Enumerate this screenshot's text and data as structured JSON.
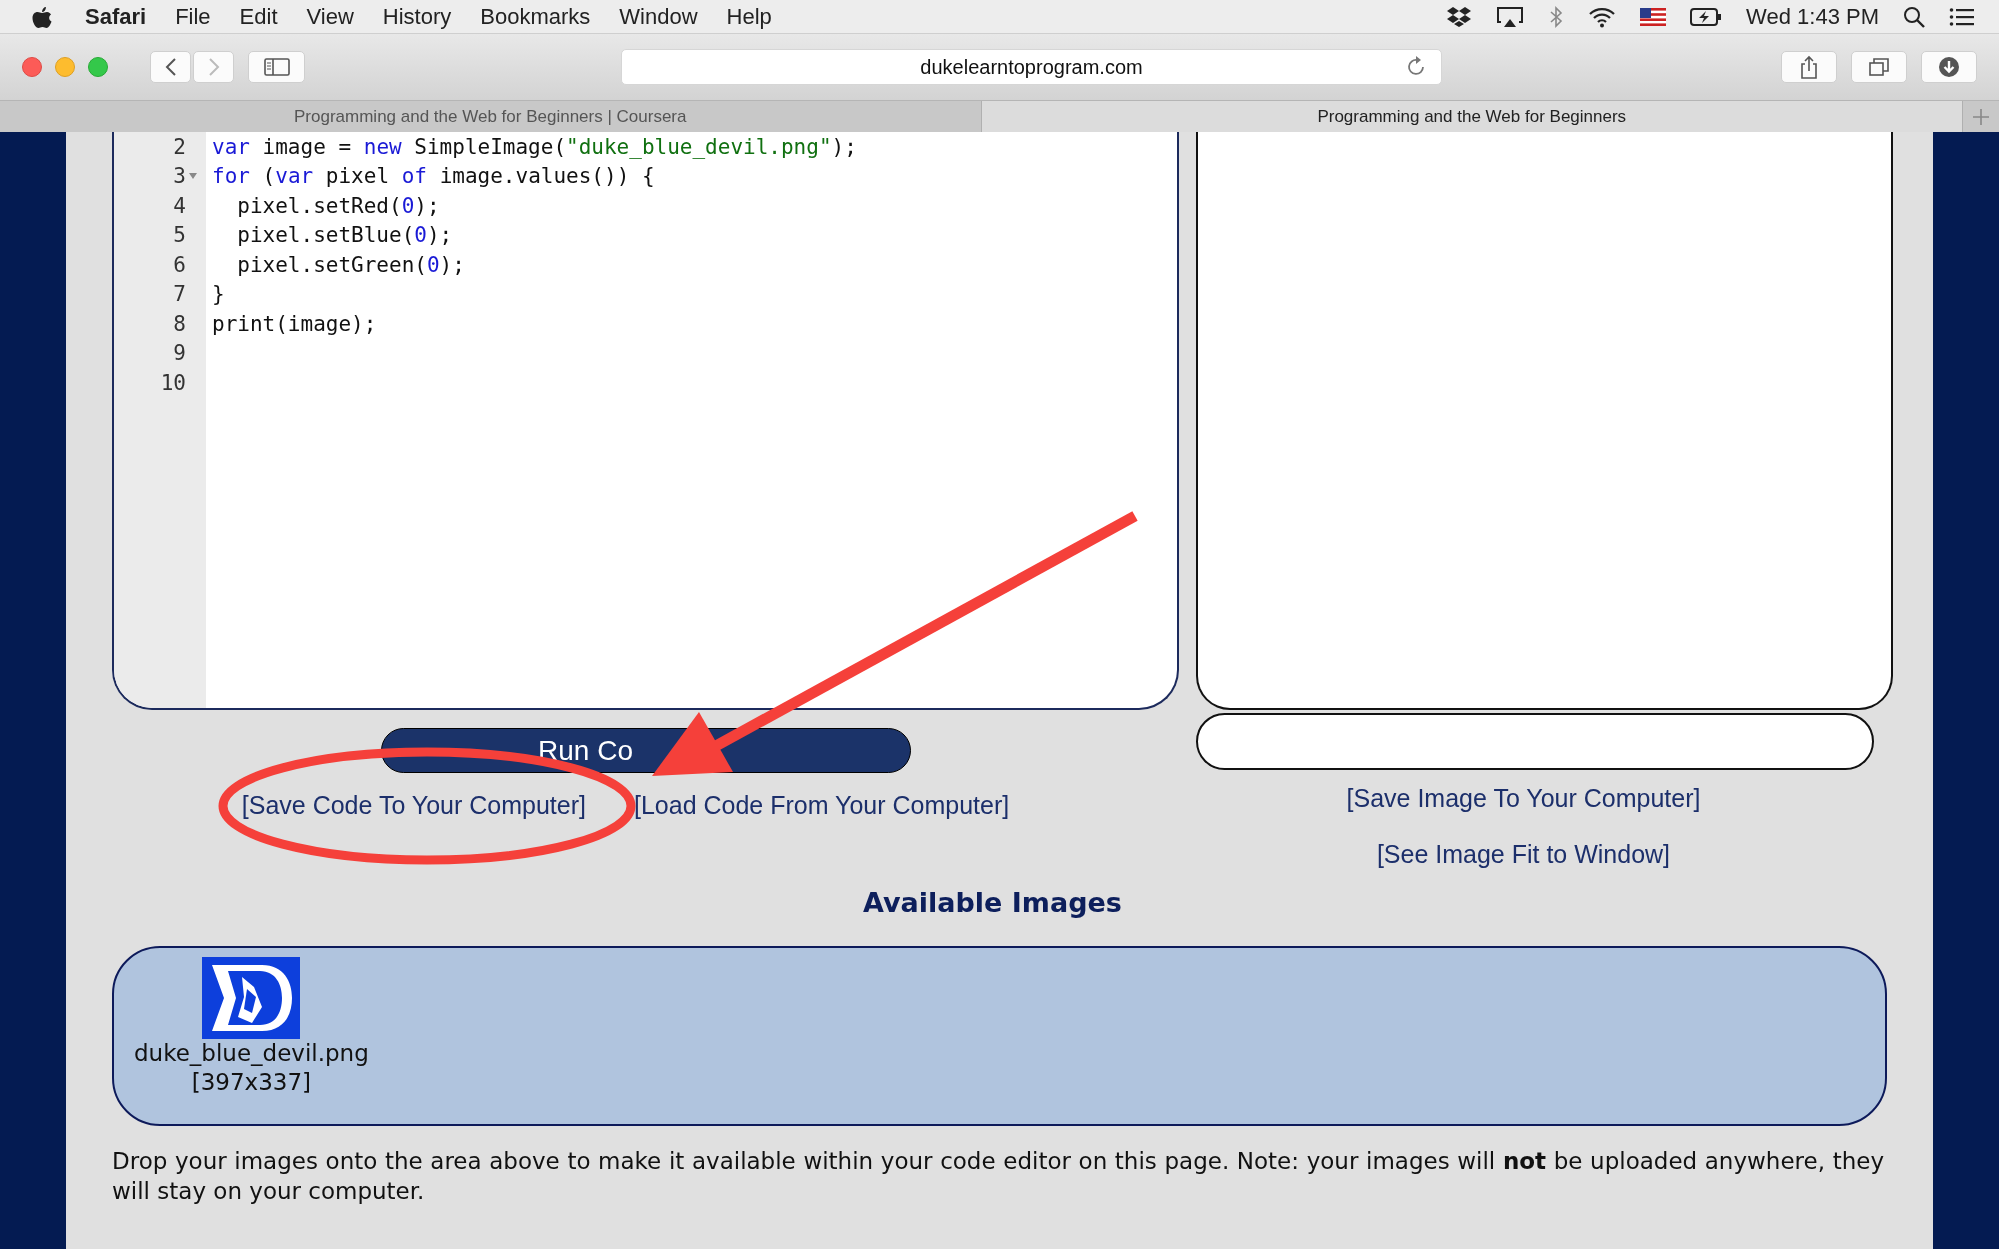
{
  "menu_bar": {
    "app": "Safari",
    "menus": [
      "File",
      "Edit",
      "View",
      "History",
      "Bookmarks",
      "Window",
      "Help"
    ],
    "clock": "Wed 1:43 PM"
  },
  "toolbar": {
    "address": "dukelearntoprogram.com"
  },
  "tabs": [
    {
      "label": "Programming and the Web for Beginners | Coursera",
      "selected": false
    },
    {
      "label": "Programming and the Web for Beginners",
      "selected": true
    }
  ],
  "editor": {
    "lines": [
      {
        "number": "2",
        "foldable": false,
        "tokens": [
          {
            "kind": "keyword",
            "text": "var"
          },
          {
            "kind": "plain",
            "text": " image = "
          },
          {
            "kind": "keyword",
            "text": "new"
          },
          {
            "kind": "plain",
            "text": " SimpleImage("
          },
          {
            "kind": "string",
            "text": "\"duke_blue_devil.png\""
          },
          {
            "kind": "plain",
            "text": ");"
          }
        ]
      },
      {
        "number": "3",
        "foldable": true,
        "tokens": [
          {
            "kind": "keyword",
            "text": "for"
          },
          {
            "kind": "plain",
            "text": " ("
          },
          {
            "kind": "keyword",
            "text": "var"
          },
          {
            "kind": "plain",
            "text": " pixel "
          },
          {
            "kind": "keyword",
            "text": "of"
          },
          {
            "kind": "plain",
            "text": " image.values()) {"
          }
        ]
      },
      {
        "number": "4",
        "foldable": false,
        "tokens": [
          {
            "kind": "plain",
            "text": "  pixel.setRed("
          },
          {
            "kind": "number",
            "text": "0"
          },
          {
            "kind": "plain",
            "text": ");"
          }
        ]
      },
      {
        "number": "5",
        "foldable": false,
        "tokens": [
          {
            "kind": "plain",
            "text": "  pixel.setBlue("
          },
          {
            "kind": "number",
            "text": "0"
          },
          {
            "kind": "plain",
            "text": ");"
          }
        ]
      },
      {
        "number": "6",
        "foldable": false,
        "tokens": [
          {
            "kind": "plain",
            "text": "  pixel.setGreen("
          },
          {
            "kind": "number",
            "text": "0"
          },
          {
            "kind": "plain",
            "text": ");"
          }
        ]
      },
      {
        "number": "7",
        "foldable": false,
        "tokens": [
          {
            "kind": "plain",
            "text": "}"
          }
        ]
      },
      {
        "number": "8",
        "foldable": false,
        "tokens": [
          {
            "kind": "plain",
            "text": "print(image);"
          }
        ]
      },
      {
        "number": "9",
        "foldable": false
      },
      {
        "number": "10",
        "foldable": false
      }
    ]
  },
  "run_button": {
    "label": "Run Co"
  },
  "code_links": [
    "[Save Code To Your Computer]",
    "[Load Code From Your Computer]"
  ],
  "image_links": [
    "[Save Image To Your Computer]",
    "[See Image Fit to Window]"
  ],
  "available_images": {
    "heading": "Available Images",
    "items": [
      {
        "kind": "picture",
        "name": "duke_blue_devil.png",
        "size": "[397x337]"
      }
    ]
  },
  "note": "Drop your images onto the area above to make it available within your code editor on this page. Note: your images will **not** be uploaded anywhere, they will stay on your computer."
}
